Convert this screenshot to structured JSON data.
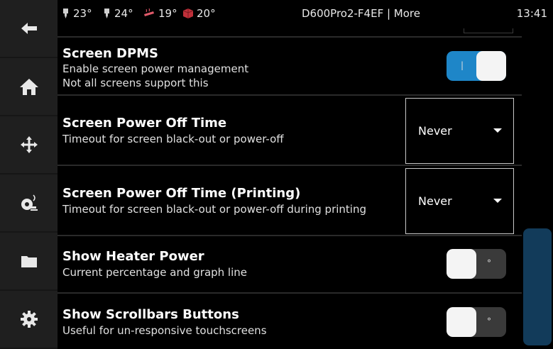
{
  "sidebar": {
    "items": [
      {
        "name": "back",
        "icon": "back-arrow-icon"
      },
      {
        "name": "home",
        "icon": "home-icon"
      },
      {
        "name": "move",
        "icon": "move-icon"
      },
      {
        "name": "extrude",
        "icon": "extruder-icon"
      },
      {
        "name": "files",
        "icon": "folder-icon"
      },
      {
        "name": "settings",
        "icon": "gear-icon"
      }
    ]
  },
  "topbar": {
    "temps": [
      {
        "value": "23°",
        "icon": "extruder-temp-icon"
      },
      {
        "value": "24°",
        "icon": "extruder-temp-icon"
      },
      {
        "value": "19°",
        "icon": "heated-bed-icon"
      },
      {
        "value": "20°",
        "icon": "chamber-icon"
      }
    ],
    "title": "D600Pro2-F4EF | More",
    "clock": "13:41"
  },
  "settings": {
    "dpms": {
      "title": "Screen DPMS",
      "desc1": "Enable screen power management",
      "desc2": "Not all screens support this",
      "state": "on",
      "on_mark": "|"
    },
    "power_off_time": {
      "title": "Screen Power Off Time",
      "desc": "Timeout for screen black-out or power-off",
      "value": "Never"
    },
    "power_off_time_printing": {
      "title": "Screen Power Off Time (Printing)",
      "desc": "Timeout for screen black-out or power-off during printing",
      "value": "Never"
    },
    "heater_power": {
      "title": "Show Heater Power",
      "desc": "Current percentage and graph line",
      "state": "off",
      "off_mark": "°"
    },
    "scrollbar_buttons": {
      "title": "Show Scrollbars Buttons",
      "desc": "Useful for un-responsive touchscreens",
      "state": "off",
      "off_mark": "°"
    }
  },
  "colors": {
    "accent": "#1e86c8",
    "sidebar_bg": "#1f1f1f",
    "scrollbar": "#123b5a"
  }
}
